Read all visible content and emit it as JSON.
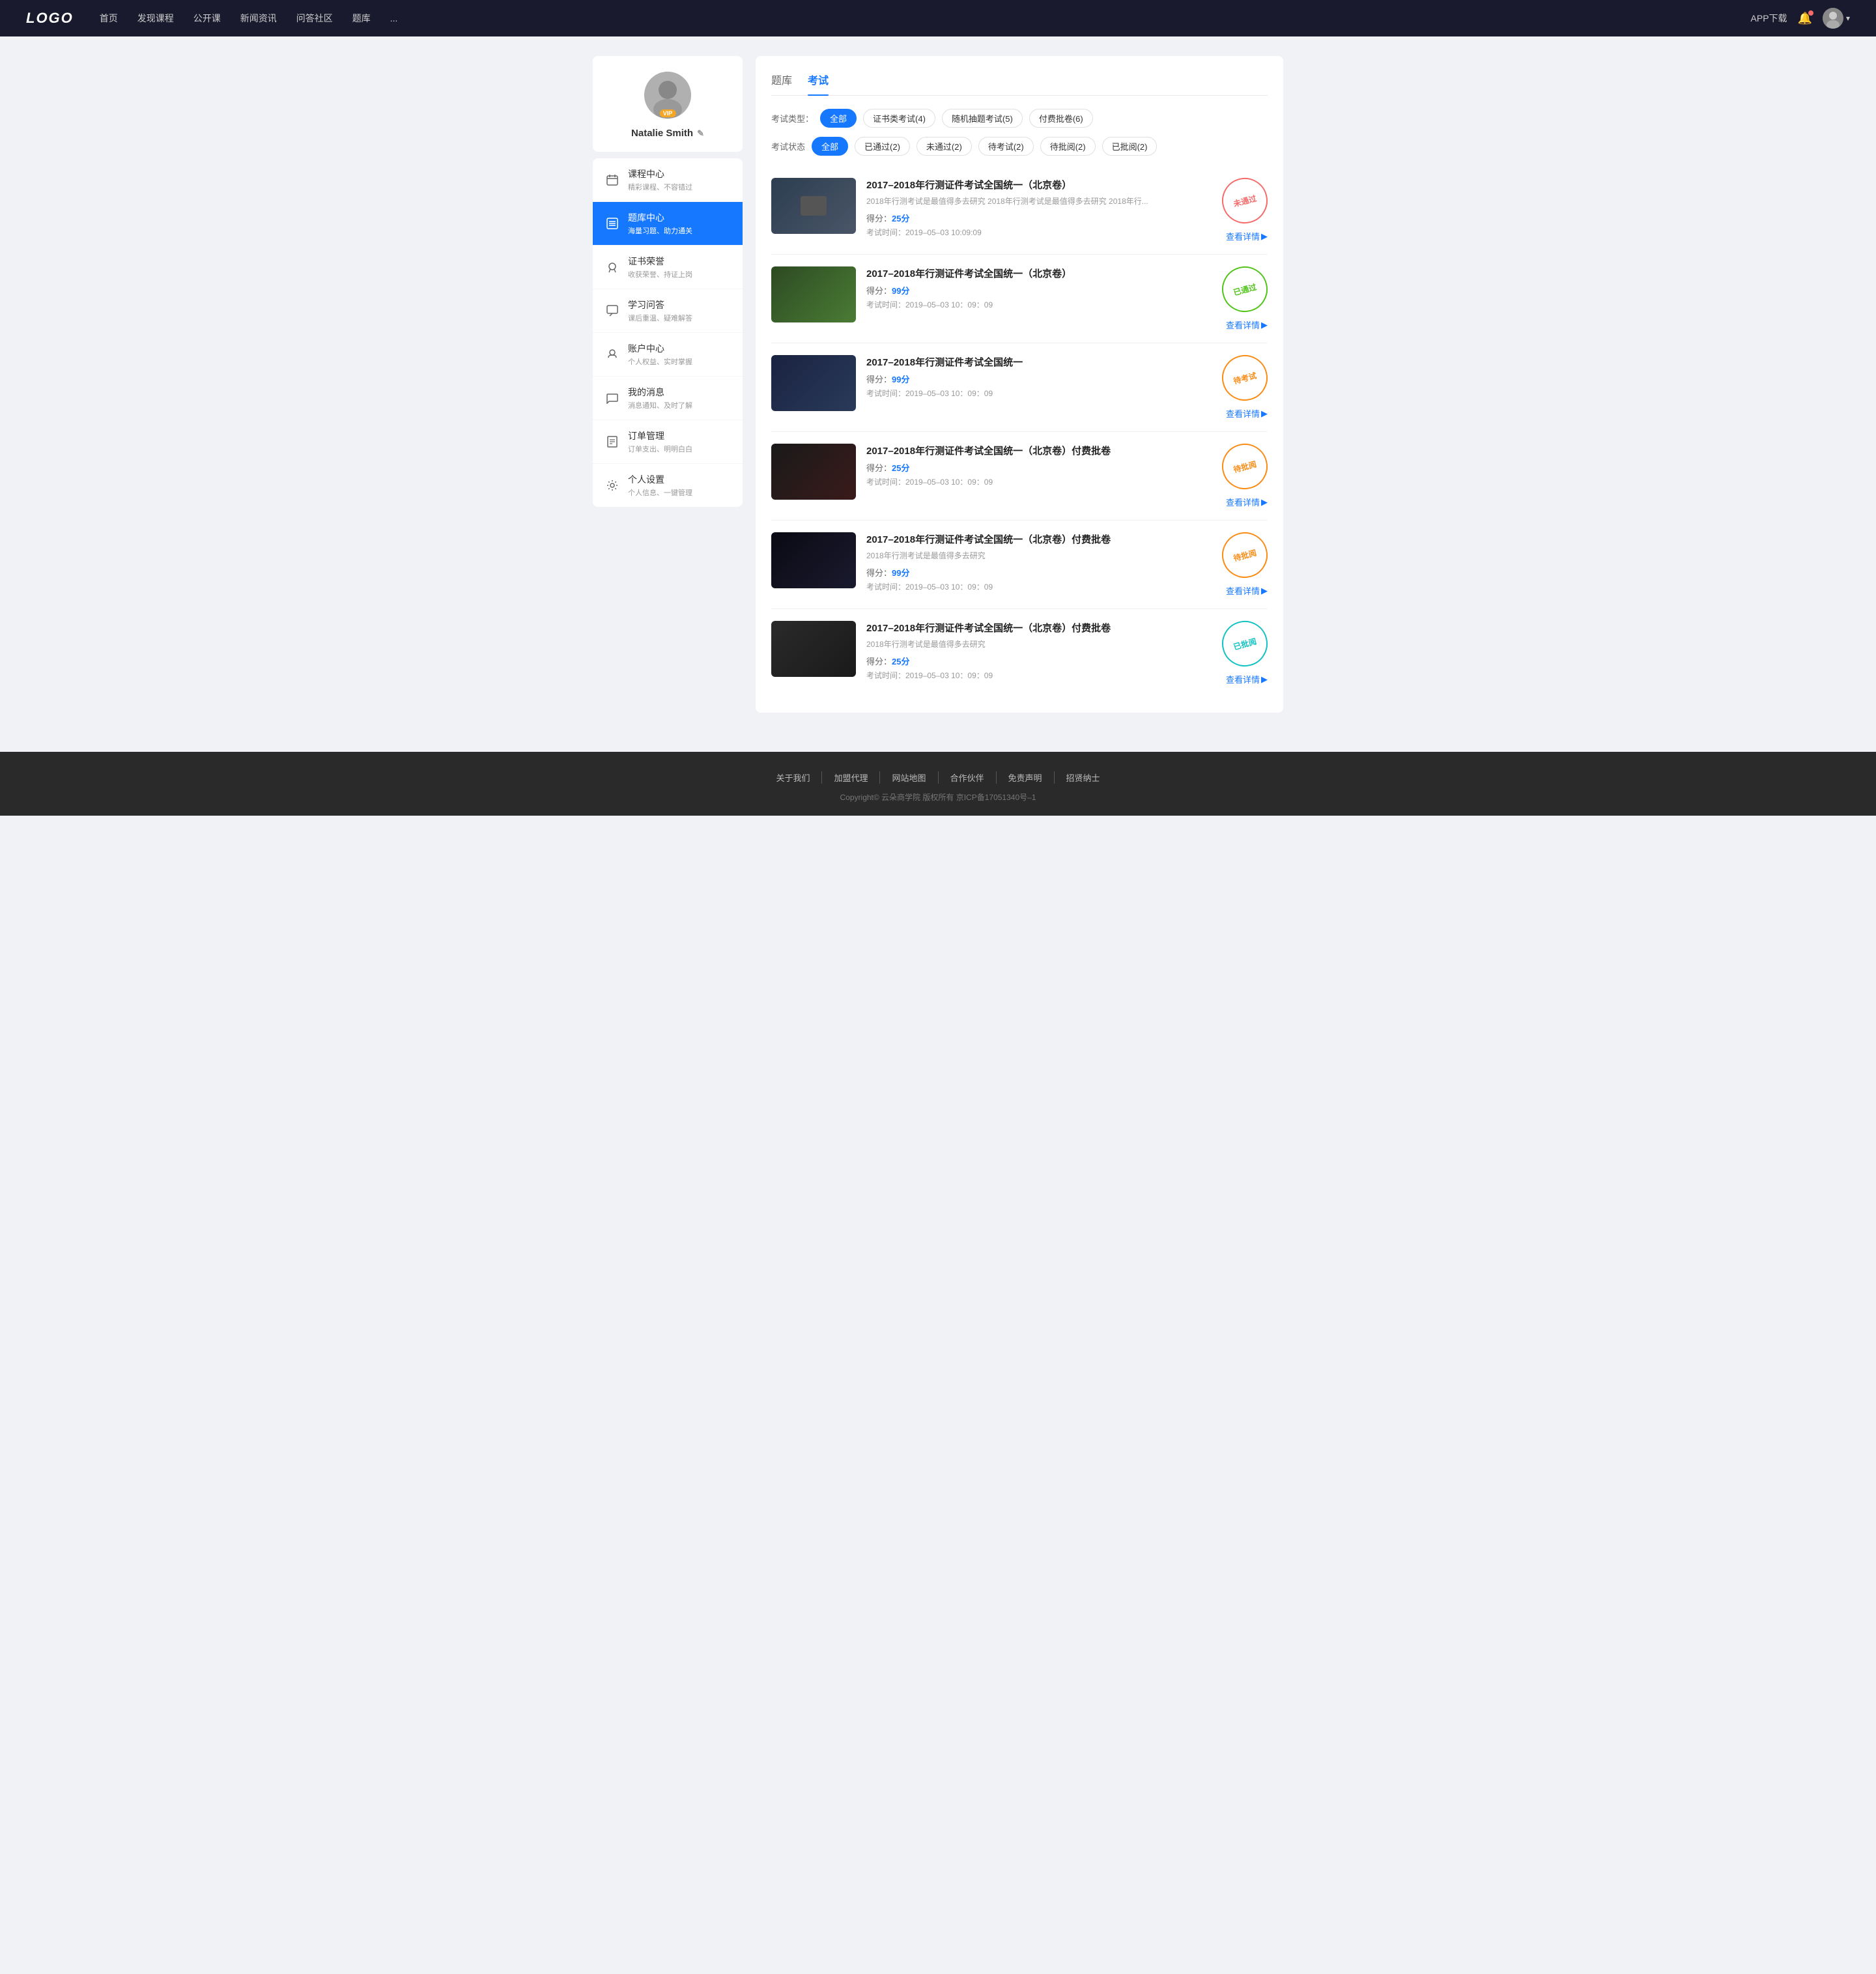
{
  "nav": {
    "logo": "LOGO",
    "menu": [
      "首页",
      "发现课程",
      "公开课",
      "新闻资讯",
      "问答社区",
      "题库",
      "..."
    ],
    "app_download": "APP下载",
    "more_icon": "···"
  },
  "sidebar": {
    "profile": {
      "name": "Natalie Smith",
      "edit_icon": "✎"
    },
    "items": [
      {
        "id": "course-center",
        "label": "课程中心",
        "desc": "精彩课程、不容错过",
        "icon": "📅"
      },
      {
        "id": "question-bank",
        "label": "题库中心",
        "desc": "海量习题、助力通关",
        "icon": "📋",
        "active": true
      },
      {
        "id": "certificate",
        "label": "证书荣誉",
        "desc": "收获荣誉、持证上岗",
        "icon": "🏅"
      },
      {
        "id": "study-qa",
        "label": "学习问答",
        "desc": "课后重温、疑难解答",
        "icon": "💬"
      },
      {
        "id": "account",
        "label": "账户中心",
        "desc": "个人权益、实时掌握",
        "icon": "🏷️"
      },
      {
        "id": "messages",
        "label": "我的消息",
        "desc": "消息通知、及时了解",
        "icon": "💭"
      },
      {
        "id": "orders",
        "label": "订单管理",
        "desc": "订单支出、明明白白",
        "icon": "📄"
      },
      {
        "id": "settings",
        "label": "个人设置",
        "desc": "个人信息、一键管理",
        "icon": "⚙️"
      }
    ]
  },
  "main": {
    "tabs": [
      {
        "label": "题库",
        "active": false
      },
      {
        "label": "考试",
        "active": true
      }
    ],
    "filters": {
      "type_label": "考试类型：",
      "type_options": [
        {
          "label": "全部",
          "active": true
        },
        {
          "label": "证书类考试(4)",
          "active": false
        },
        {
          "label": "随机抽题考试(5)",
          "active": false
        },
        {
          "label": "付费批卷(6)",
          "active": false
        }
      ],
      "status_label": "考试状态",
      "status_options": [
        {
          "label": "全部",
          "active": true
        },
        {
          "label": "已通过(2)",
          "active": false
        },
        {
          "label": "未通过(2)",
          "active": false
        },
        {
          "label": "待考试(2)",
          "active": false
        },
        {
          "label": "待批阅(2)",
          "active": false
        },
        {
          "label": "已批阅(2)",
          "active": false
        }
      ]
    },
    "exams": [
      {
        "id": 1,
        "title": "2017–2018年行测证件考试全国统一（北京卷）",
        "desc": "2018年行测考试是最值得多去研究 2018年行测考试是最值得多去研究 2018年行...",
        "score_label": "得分：",
        "score": "25分",
        "time_label": "考试时间：",
        "time": "2019–05–03  10:09:09",
        "status": "未通过",
        "status_type": "red",
        "detail_label": "查看详情",
        "thumb_class": "thumb-1"
      },
      {
        "id": 2,
        "title": "2017–2018年行测证件考试全国统一（北京卷）",
        "desc": "",
        "score_label": "得分：",
        "score": "99分",
        "time_label": "考试时间：",
        "time": "2019–05–03  10：09：09",
        "status": "已通过",
        "status_type": "green",
        "detail_label": "查看详情",
        "thumb_class": "thumb-2"
      },
      {
        "id": 3,
        "title": "2017–2018年行测证件考试全国统一",
        "desc": "",
        "score_label": "得分：",
        "score": "99分",
        "time_label": "考试时间：",
        "time": "2019–05–03  10：09：09",
        "status": "待考试",
        "status_type": "orange",
        "detail_label": "查看详情",
        "thumb_class": "thumb-3"
      },
      {
        "id": 4,
        "title": "2017–2018年行测证件考试全国统一（北京卷）付费批卷",
        "desc": "",
        "score_label": "得分：",
        "score": "25分",
        "time_label": "考试时间：",
        "time": "2019–05–03  10：09：09",
        "status": "待批阅",
        "status_type": "orange",
        "detail_label": "查看详情",
        "thumb_class": "thumb-4"
      },
      {
        "id": 5,
        "title": "2017–2018年行测证件考试全国统一（北京卷）付费批卷",
        "desc": "2018年行测考试是最值得多去研究",
        "score_label": "得分：",
        "score": "99分",
        "time_label": "考试时间：",
        "time": "2019–05–03  10：09：09",
        "status": "待批阅",
        "status_type": "orange",
        "detail_label": "查看详情",
        "thumb_class": "thumb-5"
      },
      {
        "id": 6,
        "title": "2017–2018年行测证件考试全国统一（北京卷）付费批卷",
        "desc": "2018年行测考试是最值得多去研究",
        "score_label": "得分：",
        "score": "25分",
        "time_label": "考试时间：",
        "time": "2019–05–03  10：09：09",
        "status": "已批阅",
        "status_type": "teal",
        "detail_label": "查看详情",
        "thumb_class": "thumb-6"
      }
    ]
  },
  "footer": {
    "links": [
      "关于我们",
      "加盟代理",
      "网站地图",
      "合作伙伴",
      "免责声明",
      "招贤纳士"
    ],
    "copyright": "Copyright© 云朵商学院  版权所有    京ICP备17051340号–1"
  }
}
